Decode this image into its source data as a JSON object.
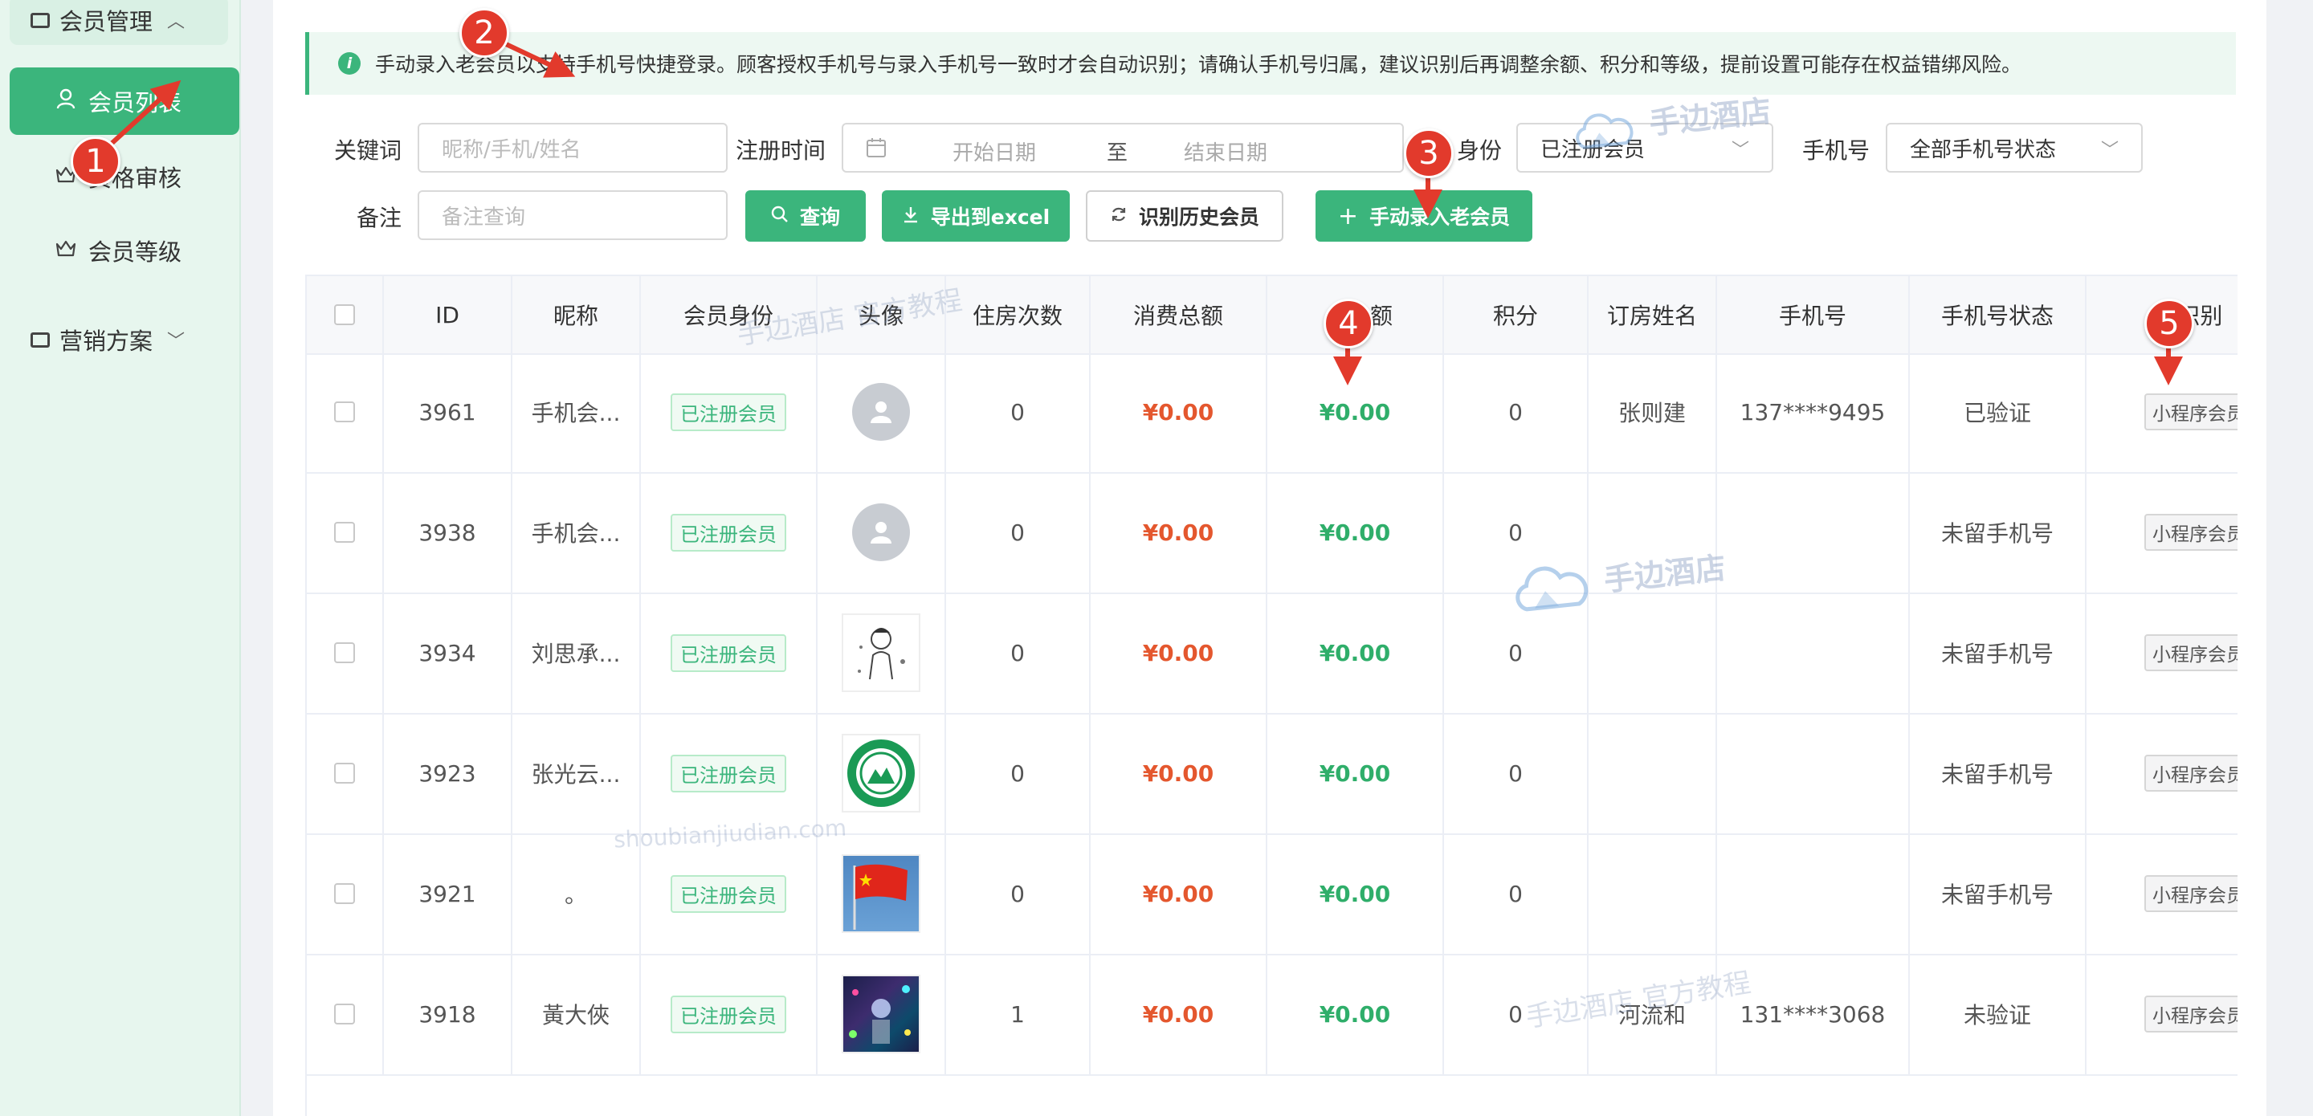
{
  "sidebar": {
    "member_mgmt": "会员管理",
    "member_list": "会员列表",
    "member_audit": "资格审核",
    "member_level": "会员等级",
    "marketing": "营销方案"
  },
  "notice": "手动录入老会员以支持手机号快捷登录。顾客授权手机号与录入手机号一致时才会自动识别；请确认手机号归属，建议识别后再调整余额、积分和等级，提前设置可能存在权益错绑风险。",
  "filters": {
    "keyword_label": "关键词",
    "keyword_placeholder": "昵称/手机/姓名",
    "regtime_label": "注册时间",
    "start_placeholder": "开始日期",
    "range_sep": "至",
    "end_placeholder": "结束日期",
    "identity_label": "身份",
    "identity_value": "已注册会员",
    "phone_label": "手机号",
    "phone_value": "全部手机号状态",
    "remark_label": "备注",
    "remark_placeholder": "备注查询"
  },
  "buttons": {
    "query": "查询",
    "export": "导出到excel",
    "identify": "识别历史会员",
    "manual": "手动录入老会员"
  },
  "table": {
    "headers": [
      "ID",
      "昵称",
      "会员身份",
      "头像",
      "住房次数",
      "消费总额",
      "额",
      "积分",
      "订房姓名",
      "手机号",
      "手机号状态",
      "/识别"
    ],
    "rows": [
      {
        "id": "3961",
        "nick": "手机会...",
        "identity": "已注册会员",
        "stays": "0",
        "total": "¥0.00",
        "balance": "¥0.00",
        "points": "0",
        "name": "张则建",
        "phone": "137****9495",
        "status": "已验证",
        "source": "小程序会员"
      },
      {
        "id": "3938",
        "nick": "手机会...",
        "identity": "已注册会员",
        "stays": "0",
        "total": "¥0.00",
        "balance": "¥0.00",
        "points": "0",
        "name": "",
        "phone": "",
        "status": "未留手机号",
        "source": "小程序会员"
      },
      {
        "id": "3934",
        "nick": "刘思承...",
        "identity": "已注册会员",
        "stays": "0",
        "total": "¥0.00",
        "balance": "¥0.00",
        "points": "0",
        "name": "",
        "phone": "",
        "status": "未留手机号",
        "source": "小程序会员"
      },
      {
        "id": "3923",
        "nick": "张光云...",
        "identity": "已注册会员",
        "stays": "0",
        "total": "¥0.00",
        "balance": "¥0.00",
        "points": "0",
        "name": "",
        "phone": "",
        "status": "未留手机号",
        "source": "小程序会员"
      },
      {
        "id": "3921",
        "nick": "。",
        "identity": "已注册会员",
        "stays": "0",
        "total": "¥0.00",
        "balance": "¥0.00",
        "points": "0",
        "name": "",
        "phone": "",
        "status": "未留手机号",
        "source": "小程序会员"
      },
      {
        "id": "3918",
        "nick": "黃大俠",
        "identity": "已注册会员",
        "stays": "1",
        "total": "¥0.00",
        "balance": "¥0.00",
        "points": "0",
        "name": "河流和",
        "phone": "131****3068",
        "status": "未验证",
        "source": "小程序会员"
      }
    ]
  },
  "annotations": [
    "1",
    "2",
    "3",
    "4",
    "5"
  ],
  "watermarks": {
    "brand": "手边酒店",
    "tutorial_a": "手边酒店 官方教程",
    "tutorial_b": "手边酒店 官方教程",
    "site": "shoubianjiudian.com"
  },
  "colors": {
    "accent": "#3bb57c",
    "money_red": "#e4572e",
    "money_green": "#2fae6a",
    "marker": "#e23a2c"
  }
}
